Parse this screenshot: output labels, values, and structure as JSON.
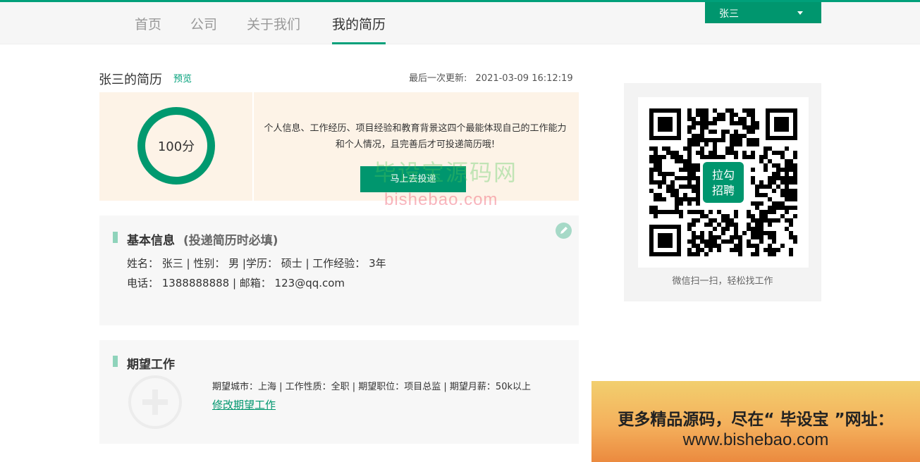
{
  "nav": {
    "items": [
      {
        "label": "首页"
      },
      {
        "label": "公司"
      },
      {
        "label": "关于我们"
      },
      {
        "label": "我的简历"
      }
    ],
    "active_index": 3
  },
  "user_menu": {
    "name": "张三",
    "icon": "caret-down-icon"
  },
  "resume": {
    "title": "张三的简历",
    "preview_label": "预览",
    "update_label": "最后一次更新:",
    "update_time": "2021-03-09 16:12:19"
  },
  "score": {
    "value": "100分",
    "description": "个人信息、工作经历、项目经验和教育背景这四个最能体现自己的工作能力和个人情况，且完善后才可投递简历哦!",
    "deliver_button": "马上去投递"
  },
  "basic_info": {
    "title": "基本信息",
    "note": "(投递简历时必填)",
    "line1": "姓名：  张三 | 性别：  男 |学历：  硕士 | 工作经验：  3年",
    "line2": "电话：  1388888888 | 邮箱：  123@qq.com",
    "edit_icon": "pencil-icon"
  },
  "expectation": {
    "title": "期望工作",
    "line": "期望城市：上海 | 工作性质：全职 | 期望职位：项目总监 | 期望月薪：50k以上",
    "edit_link": "修改期望工作",
    "add_icon": "plus-circle-icon"
  },
  "qr": {
    "center_label_1": "拉勾",
    "center_label_2": "招聘",
    "caption": "微信扫一扫，轻松找工作"
  },
  "watermark": {
    "cn": "毕设宝源码网",
    "en": "bishebao.com"
  },
  "ad": {
    "line1": "更多精品源码，尽在“ 毕设宝 ”网址：",
    "line2": "www.bishebao.com"
  },
  "colors": {
    "accent": "#00a07a",
    "button": "#00966e",
    "score_bg": "#fdf3e7"
  }
}
